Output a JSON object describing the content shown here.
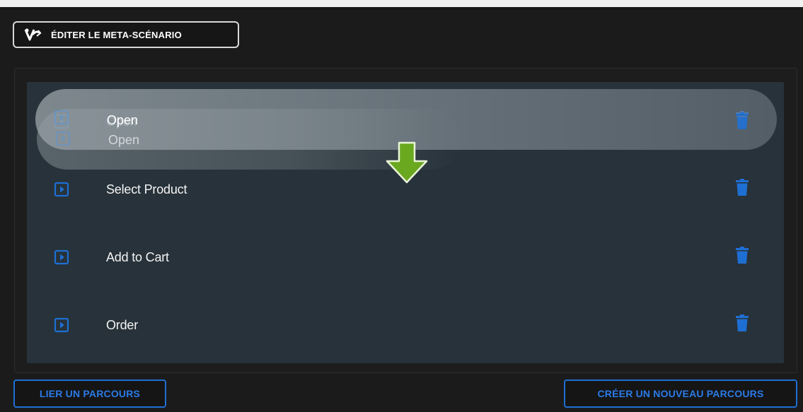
{
  "toolbar": {
    "meta_button_label": "ÉDITER LE META-SCÉNARIO",
    "meta_icon": "branch-v-icon"
  },
  "drag": {
    "label": "Open",
    "ghost_label": "Open",
    "arrow_icon": "down-arrow-icon",
    "arrow_color": "#6aa820"
  },
  "steps": [
    {
      "label": "Select Product",
      "icon": "play-square-icon"
    },
    {
      "label": "Add to Cart",
      "icon": "play-square-icon"
    },
    {
      "label": "Order",
      "icon": "play-square-icon"
    }
  ],
  "actions": {
    "link_label": "LIER UN PARCOURS",
    "create_label": "CRÉER UN NOUVEAU PARCOURS"
  },
  "colors": {
    "accent": "#2b7ae6",
    "list_bg": "#27323a",
    "page_bg": "#1b1b1b"
  }
}
